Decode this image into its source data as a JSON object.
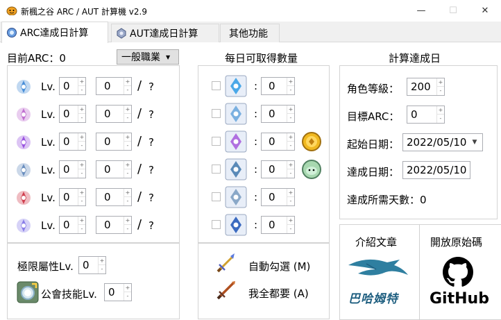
{
  "window": {
    "title": "新楓之谷 ARC / AUT 計算機  v2.9",
    "minimize": "—",
    "maximize": "☐",
    "close": "✕"
  },
  "tabs": [
    {
      "label": "ARC達成日計算",
      "icon": "arcane-symbol-icon",
      "active": true
    },
    {
      "label": "AUT達成日計算",
      "icon": "authentic-symbol-icon",
      "active": false
    },
    {
      "label": "其他功能",
      "active": false
    }
  ],
  "left": {
    "current_arc_label": "目前ARC：0",
    "job_select": "一般職業",
    "level_prefix": "Lv.",
    "slash": "/",
    "question": "?",
    "symbols": [
      {
        "name": "vanishing-journey",
        "level": "0",
        "count": "0",
        "color": "#4a8fd8"
      },
      {
        "name": "chu-chu-island",
        "level": "0",
        "count": "0",
        "color": "#c070d0"
      },
      {
        "name": "lachelein",
        "level": "0",
        "count": "0",
        "color": "#9b55e0"
      },
      {
        "name": "arcana",
        "level": "0",
        "count": "0",
        "color": "#6a8fbf"
      },
      {
        "name": "morass",
        "level": "0",
        "count": "0",
        "color": "#d04050"
      },
      {
        "name": "esfera",
        "level": "0",
        "count": "0",
        "color": "#8a7ee8"
      }
    ],
    "extreme_attr_label": "極限屬性Lv.",
    "extreme_attr_value": "0",
    "guild_skill_label": "公會技能Lv.",
    "guild_skill_value": "0"
  },
  "middle": {
    "title": "每日可取得數量",
    "colon": ":",
    "daily": [
      {
        "value": "0",
        "icon": "vanishing-journey-icon",
        "color": "#4aa8e8"
      },
      {
        "value": "0",
        "icon": "chu-chu-island-icon",
        "color": "#7ab0e0"
      },
      {
        "value": "0",
        "icon": "lachelein-icon",
        "color": "#b070e0"
      },
      {
        "value": "0",
        "icon": "arcana-icon",
        "color": "#5a8ab8"
      },
      {
        "value": "0",
        "icon": "morass-icon",
        "color": "#8aa8c8"
      },
      {
        "value": "0",
        "icon": "esfera-icon",
        "color": "#3a6ac0"
      }
    ],
    "auto_check": "自動勾選 (M)",
    "want_all": "我全都要 (A)"
  },
  "right": {
    "title": "計算達成日",
    "char_level_label": "角色等級：",
    "char_level": "200",
    "target_arc_label": "目標ARC：",
    "target_arc": "0",
    "start_date_label": "起始日期：",
    "start_date": "2022/05/10",
    "done_date_label": "達成日期：",
    "done_date": "2022/05/10",
    "days_needed": "達成所需天數：0",
    "article_label": "介紹文章",
    "source_label": "開放原始碼",
    "bahamut_text": "巴哈姆特",
    "github_text": "GitHub"
  }
}
